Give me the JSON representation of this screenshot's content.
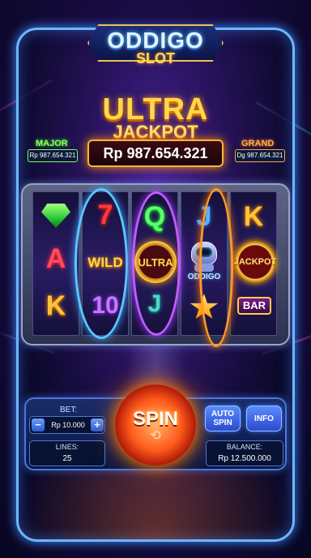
{
  "header": {
    "title": "ODDIGO",
    "subtitle": "SLOT"
  },
  "jackpot": {
    "title_line1": "ULTRA",
    "title_line2": "JACKPOT",
    "amount": "Rp 987.654.321",
    "major_label": "MAJOR",
    "major_amount": "Rp 987.654.321",
    "grand_label": "GRAND",
    "grand_amount": "Dg 987.654.321"
  },
  "reels": [
    {
      "symbols": [
        "gem-icon",
        "A",
        "K"
      ]
    },
    {
      "symbols": [
        "7",
        "WILD",
        "10"
      ]
    },
    {
      "symbols": [
        "Q",
        "ULTRA",
        "J"
      ]
    },
    {
      "symbols": [
        "J",
        "ODDIGO",
        "star-icon"
      ]
    },
    {
      "symbols": [
        "K",
        "JACKPOT",
        "BAR"
      ]
    }
  ],
  "symbol_labels": {
    "r1_row2": "A",
    "r1_row3": "K",
    "r2_row1": "7",
    "r2_row2": "WILD",
    "r2_row3": "10",
    "r3_row1": "Q",
    "r3_row2": "ULTRA",
    "r3_row3": "J",
    "r4_row1": "J",
    "r4_row2": "ODDIGO",
    "r5_row1": "K",
    "r5_row2": "JACKPOT",
    "r5_row3": "BAR"
  },
  "controls": {
    "bet_label": "BET:",
    "bet_value": "Rp 10.000",
    "minus": "−",
    "plus": "+",
    "lines_label": "LINES:",
    "lines_value": "25",
    "spin_label": "SPIN",
    "auto_spin_line1": "AUTO",
    "auto_spin_line2": "SPIN",
    "info_label": "INFO",
    "balance_label": "BALANCE:",
    "balance_value": "Rp 12.500.000"
  },
  "colors": {
    "frame": "#6fb6ff",
    "gold": "#ffd84a",
    "spin": "#ff5a1a"
  }
}
